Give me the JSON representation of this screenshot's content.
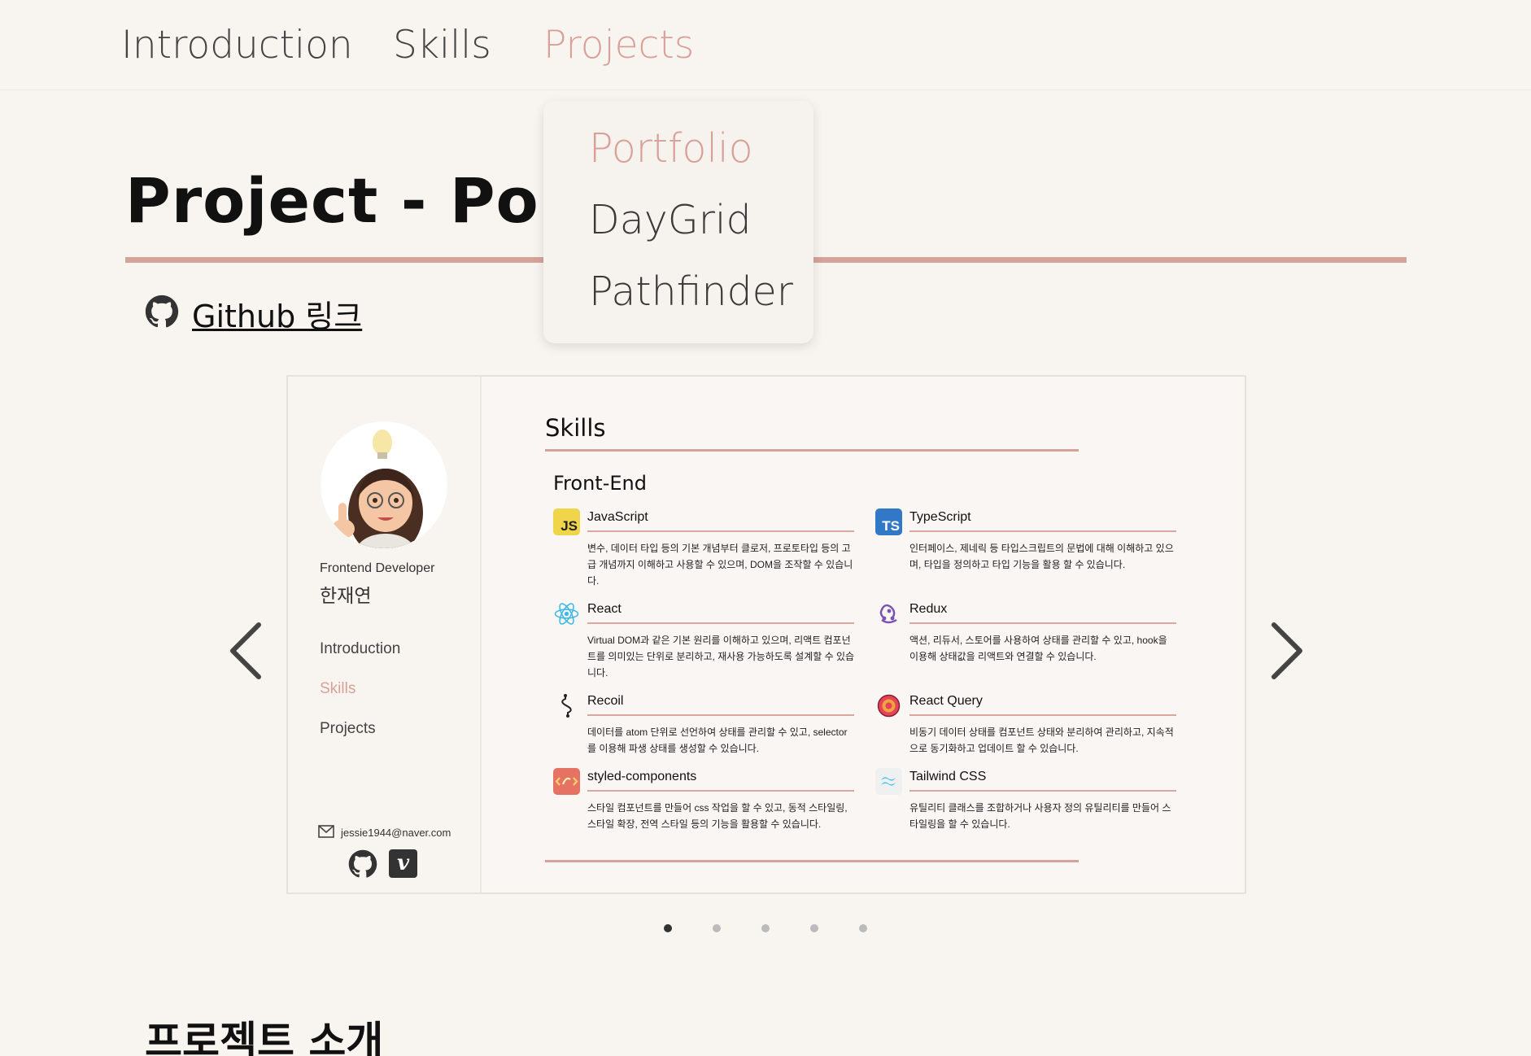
{
  "nav": {
    "items": [
      "Introduction",
      "Skills",
      "Projects"
    ],
    "active": "Projects"
  },
  "dropdown": {
    "items": [
      "Portfolio",
      "DayGrid",
      "Pathfinder"
    ],
    "active": "Portfolio"
  },
  "page": {
    "title": "Project - Portfolio",
    "github_link": "Github 링크",
    "section_title": "프로젝트 소개"
  },
  "slide": {
    "sidebar": {
      "role": "Frontend Developer",
      "name": "한재연",
      "nav": [
        "Introduction",
        "Skills",
        "Projects"
      ],
      "active": "Skills",
      "email": "jessie1944@naver.com",
      "vimeo_glyph": "v"
    },
    "skills_title": "Skills",
    "group_title": "Front-End",
    "skills": [
      {
        "name": "JavaScript",
        "icon": "js-icon",
        "icon_text": "JS",
        "desc": "변수, 데이터 타입 등의 기본 개념부터 클로저, 프로토타입 등의 고급 개념까지 이해하고 사용할 수 있으며, DOM을 조작할 수 있습니다."
      },
      {
        "name": "TypeScript",
        "icon": "ts-icon",
        "icon_text": "TS",
        "desc": "인터페이스, 제네릭 등 타입스크립트의 문법에 대해 이해하고 있으며, 타입을 정의하고 타입 기능을 활용 할 수 있습니다."
      },
      {
        "name": "React",
        "icon": "react-icon",
        "icon_text": "",
        "desc": "Virtual DOM과 같은 기본 원리를 이해하고 있으며, 리액트 컴포넌트를 의미있는 단위로 분리하고, 재사용 가능하도록 설계할 수 있습니다."
      },
      {
        "name": "Redux",
        "icon": "redux-icon",
        "icon_text": "",
        "desc": "액션, 리듀서, 스토어를 사용하여 상태를 관리할 수 있고, hook을 이용해 상태값을 리액트와 연결할 수 있습니다."
      },
      {
        "name": "Recoil",
        "icon": "recoil-icon",
        "icon_text": "",
        "desc": "데이터를 atom 단위로 선언하여 상태를 관리할 수 있고, selector를 이용해 파생 상태를 생성할 수 있습니다."
      },
      {
        "name": "React Query",
        "icon": "react-query-icon",
        "icon_text": "",
        "desc": "비동기 데이터 상태를 컴포넌트 상태와 분리하여 관리하고, 지속적으로 동기화하고 업데이트 할 수 있습니다."
      },
      {
        "name": "styled-components",
        "icon": "styled-components-icon",
        "icon_text": "",
        "desc": "스타일 컴포넌트를 만들어 css 작업을 할 수 있고, 동적 스타일링, 스타일 확장, 전역 스타일 등의 기능을 활용할 수 있습니다."
      },
      {
        "name": "Tailwind CSS",
        "icon": "tailwind-icon",
        "icon_text": "",
        "desc": "유틸리티 클래스를 조합하거나 사용자 정의 유틸리티를 만들어 스타일링을 할 수 있습니다."
      }
    ]
  },
  "carousel": {
    "slide_count": 5,
    "active_index": 0
  },
  "colors": {
    "accent": "#d8a098",
    "rule": "#d4a49b",
    "background": "#f8f5f1"
  }
}
